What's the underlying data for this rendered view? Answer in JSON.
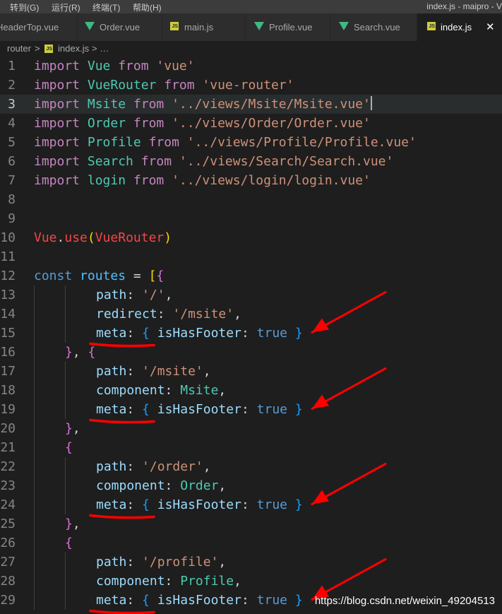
{
  "menu": {
    "items": [
      "转到(G)",
      "运行(R)",
      "终端(T)",
      "帮助(H)"
    ],
    "window_title": "index.js - maipro - V"
  },
  "tabs": [
    {
      "label": "HeaderTop.vue",
      "icon": "vue-icon"
    },
    {
      "label": "Order.vue",
      "icon": "vue-icon"
    },
    {
      "label": "main.js",
      "icon": "js-icon"
    },
    {
      "label": "Profile.vue",
      "icon": "vue-icon"
    },
    {
      "label": "Search.vue",
      "icon": "vue-icon"
    },
    {
      "label": "index.js",
      "icon": "js-icon",
      "active": true,
      "close": "✕"
    }
  ],
  "breadcrumb": {
    "folder": "router",
    "sep": ">",
    "file": "index.js",
    "tail": "> …",
    "file_icon": "JS"
  },
  "editor": {
    "current_line": 3,
    "lines": [
      {
        "n": "1",
        "tokens": [
          [
            "keyword",
            "import "
          ],
          [
            "class",
            "Vue "
          ],
          [
            "keyword",
            "from "
          ],
          [
            "string",
            "'vue'"
          ]
        ]
      },
      {
        "n": "2",
        "tokens": [
          [
            "keyword",
            "import "
          ],
          [
            "class",
            "VueRouter "
          ],
          [
            "keyword",
            "from "
          ],
          [
            "string",
            "'vue-router'"
          ]
        ]
      },
      {
        "n": "3",
        "tokens": [
          [
            "keyword",
            "import "
          ],
          [
            "class",
            "Msite "
          ],
          [
            "keyword",
            "from "
          ],
          [
            "string",
            "'../views/Msite/Msite.vue'"
          ]
        ]
      },
      {
        "n": "4",
        "tokens": [
          [
            "keyword",
            "import "
          ],
          [
            "class",
            "Order "
          ],
          [
            "keyword",
            "from "
          ],
          [
            "string",
            "'../views/Order/Order.vue'"
          ]
        ]
      },
      {
        "n": "5",
        "tokens": [
          [
            "keyword",
            "import "
          ],
          [
            "class",
            "Profile "
          ],
          [
            "keyword",
            "from "
          ],
          [
            "string",
            "'../views/Profile/Profile.vue'"
          ]
        ]
      },
      {
        "n": "6",
        "tokens": [
          [
            "keyword",
            "import "
          ],
          [
            "class",
            "Search "
          ],
          [
            "keyword",
            "from "
          ],
          [
            "string",
            "'../views/Search/Search.vue'"
          ]
        ]
      },
      {
        "n": "7",
        "tokens": [
          [
            "keyword",
            "import "
          ],
          [
            "class",
            "login "
          ],
          [
            "keyword",
            "from "
          ],
          [
            "string",
            "'../views/login/login.vue'"
          ]
        ]
      },
      {
        "n": "8",
        "tokens": []
      },
      {
        "n": "9",
        "tokens": []
      },
      {
        "n": "10",
        "tokens": [
          [
            "red",
            "Vue"
          ],
          [
            "punct",
            "."
          ],
          [
            "red",
            "use"
          ],
          [
            "brace",
            "("
          ],
          [
            "red",
            "VueRouter"
          ],
          [
            "brace",
            ")"
          ]
        ]
      },
      {
        "n": "11",
        "tokens": []
      },
      {
        "n": "12",
        "tokens": [
          [
            "decl",
            "const "
          ],
          [
            "var",
            "routes "
          ],
          [
            "punct",
            "= "
          ],
          [
            "brace",
            "["
          ],
          [
            "brace2",
            "{"
          ]
        ]
      },
      {
        "n": "13",
        "indent": 2,
        "tokens": [
          [
            "prop",
            "path"
          ],
          [
            "punct",
            ": "
          ],
          [
            "string",
            "'/'"
          ],
          [
            "punct",
            ","
          ]
        ]
      },
      {
        "n": "14",
        "indent": 2,
        "tokens": [
          [
            "prop",
            "redirect"
          ],
          [
            "punct",
            ": "
          ],
          [
            "string",
            "'/msite'"
          ],
          [
            "punct",
            ","
          ]
        ]
      },
      {
        "n": "15",
        "indent": 2,
        "tokens": [
          [
            "prop",
            "meta"
          ],
          [
            "punct",
            ": "
          ],
          [
            "brace3",
            "{ "
          ],
          [
            "prop",
            "isHasFooter"
          ],
          [
            "punct",
            ": "
          ],
          [
            "bool",
            "true "
          ],
          [
            "brace3",
            "}"
          ]
        ]
      },
      {
        "n": "16",
        "indent": 1,
        "tokens": [
          [
            "brace2",
            "}"
          ],
          [
            "punct",
            ", "
          ],
          [
            "brace2",
            "{"
          ]
        ]
      },
      {
        "n": "17",
        "indent": 2,
        "tokens": [
          [
            "prop",
            "path"
          ],
          [
            "punct",
            ": "
          ],
          [
            "string",
            "'/msite'"
          ],
          [
            "punct",
            ","
          ]
        ]
      },
      {
        "n": "18",
        "indent": 2,
        "tokens": [
          [
            "prop",
            "component"
          ],
          [
            "punct",
            ": "
          ],
          [
            "class",
            "Msite"
          ],
          [
            "punct",
            ","
          ]
        ]
      },
      {
        "n": "19",
        "indent": 2,
        "tokens": [
          [
            "prop",
            "meta"
          ],
          [
            "punct",
            ": "
          ],
          [
            "brace3",
            "{ "
          ],
          [
            "prop",
            "isHasFooter"
          ],
          [
            "punct",
            ": "
          ],
          [
            "bool",
            "true "
          ],
          [
            "brace3",
            "}"
          ]
        ]
      },
      {
        "n": "20",
        "indent": 1,
        "tokens": [
          [
            "brace2",
            "}"
          ],
          [
            "punct",
            ","
          ]
        ]
      },
      {
        "n": "21",
        "indent": 1,
        "tokens": [
          [
            "brace2",
            "{"
          ]
        ]
      },
      {
        "n": "22",
        "indent": 2,
        "tokens": [
          [
            "prop",
            "path"
          ],
          [
            "punct",
            ": "
          ],
          [
            "string",
            "'/order'"
          ],
          [
            "punct",
            ","
          ]
        ]
      },
      {
        "n": "23",
        "indent": 2,
        "tokens": [
          [
            "prop",
            "component"
          ],
          [
            "punct",
            ": "
          ],
          [
            "class",
            "Order"
          ],
          [
            "punct",
            ","
          ]
        ]
      },
      {
        "n": "24",
        "indent": 2,
        "tokens": [
          [
            "prop",
            "meta"
          ],
          [
            "punct",
            ": "
          ],
          [
            "brace3",
            "{ "
          ],
          [
            "prop",
            "isHasFooter"
          ],
          [
            "punct",
            ": "
          ],
          [
            "bool",
            "true "
          ],
          [
            "brace3",
            "}"
          ]
        ]
      },
      {
        "n": "25",
        "indent": 1,
        "tokens": [
          [
            "brace2",
            "}"
          ],
          [
            "punct",
            ","
          ]
        ]
      },
      {
        "n": "26",
        "indent": 1,
        "tokens": [
          [
            "brace2",
            "{"
          ]
        ]
      },
      {
        "n": "27",
        "indent": 2,
        "tokens": [
          [
            "prop",
            "path"
          ],
          [
            "punct",
            ": "
          ],
          [
            "string",
            "'/profile'"
          ],
          [
            "punct",
            ","
          ]
        ]
      },
      {
        "n": "28",
        "indent": 2,
        "tokens": [
          [
            "prop",
            "component"
          ],
          [
            "punct",
            ": "
          ],
          [
            "class",
            "Profile"
          ],
          [
            "punct",
            ","
          ]
        ]
      },
      {
        "n": "29",
        "indent": 2,
        "tokens": [
          [
            "prop",
            "meta"
          ],
          [
            "punct",
            ": "
          ],
          [
            "brace3",
            "{ "
          ],
          [
            "prop",
            "isHasFooter"
          ],
          [
            "punct",
            ": "
          ],
          [
            "bool",
            "true "
          ],
          [
            "brace3",
            "}"
          ]
        ]
      }
    ]
  },
  "annotations": {
    "color": "#ff0000",
    "arrow_lines": [
      15,
      19,
      24,
      29
    ]
  },
  "watermark": "https://blog.csdn.net/weixin_49204513"
}
